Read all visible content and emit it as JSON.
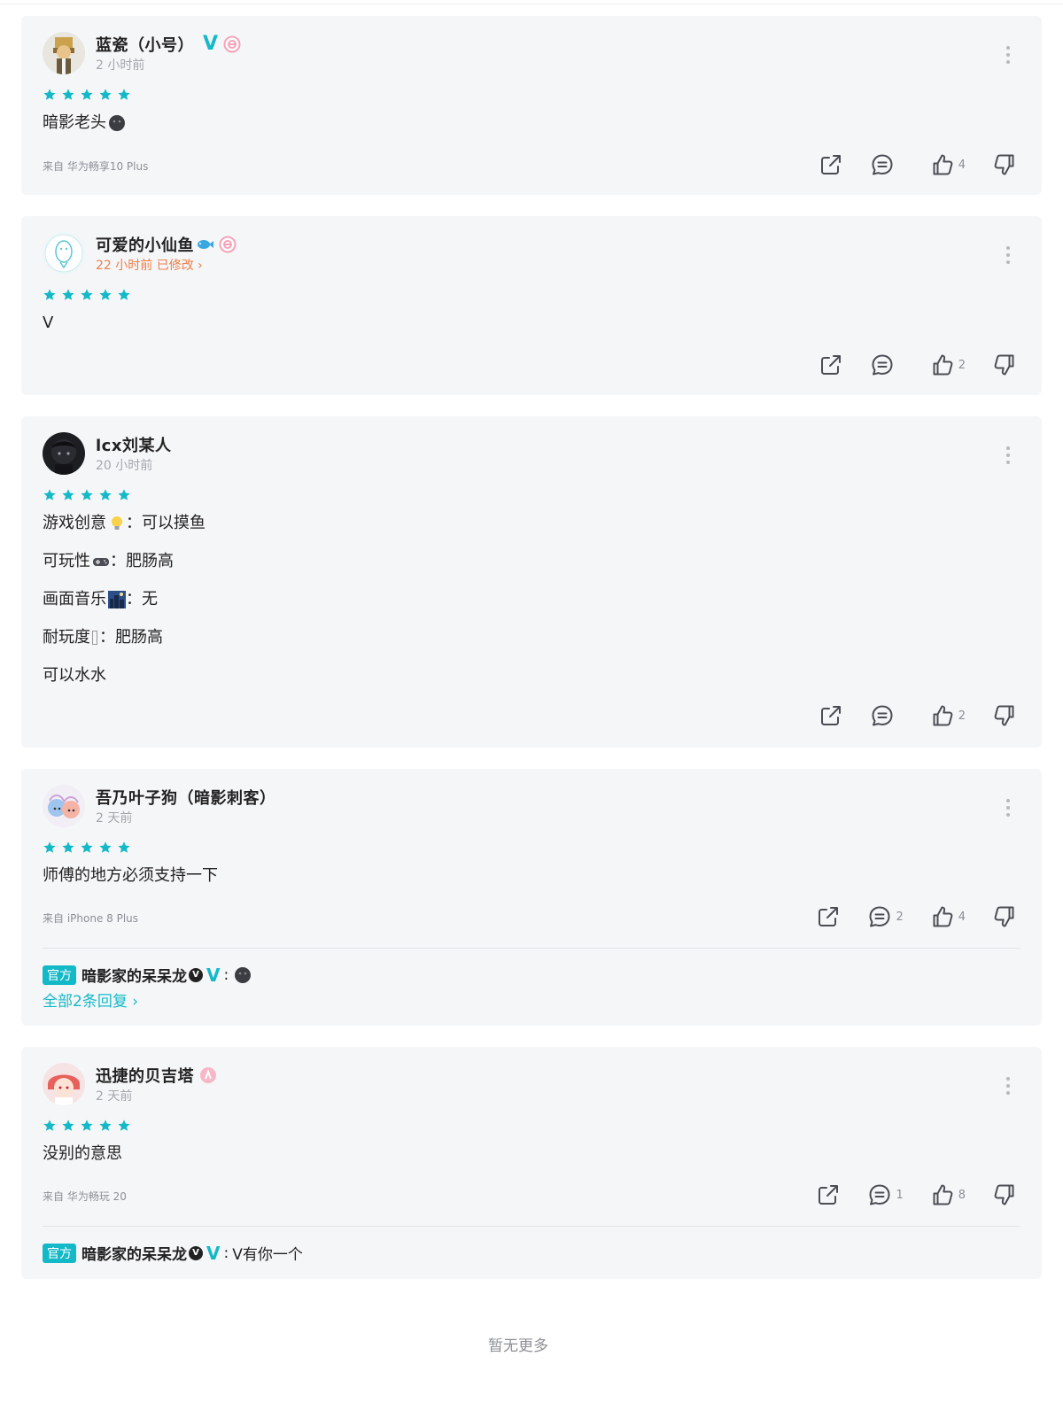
{
  "footer_text": "暂无更多",
  "reviews": [
    {
      "user": "蓝瓷（小号）",
      "time": "2 小时前",
      "rating": 5,
      "content": [
        "暗影老头"
      ],
      "device": "来自 华为畅享10 Plus",
      "likes": "4",
      "replies": "",
      "badges": [
        "v-verified",
        "pink-circle-badge"
      ]
    },
    {
      "user": "可爱的小仙鱼",
      "time": "22 小时前 已修改",
      "rating": 5,
      "content": [
        "V"
      ],
      "device": "",
      "likes": "2",
      "replies": "",
      "badges": [
        "fish-emoji",
        "pink-circle-badge"
      ]
    },
    {
      "user": "lcx刘某人",
      "time": "20 小时前",
      "rating": 5,
      "content": [
        "游戏创意",
        "：可以摸鱼",
        "可玩性",
        "：肥肠高",
        "画面音乐",
        "：无",
        "耐玩度",
        "：肥肠高",
        "可以水水"
      ],
      "device": "",
      "likes": "2",
      "replies": ""
    },
    {
      "user": "吾乃叶子狗（暗影刺客）",
      "time": "2 天前",
      "rating": 5,
      "content": [
        "师傅的地方必须支持一下"
      ],
      "device": "来自 iPhone 8 Plus",
      "likes": "4",
      "replies": "2",
      "official_reply": {
        "tag": "官方",
        "name": "暗影家的呆呆龙",
        "colon": ":",
        "text": ""
      },
      "all_replies": "全部2条回复"
    },
    {
      "user": "迅捷的贝吉塔",
      "time": "2 天前",
      "rating": 5,
      "content": [
        "没别的意思"
      ],
      "device": "来自 华为畅玩 20",
      "likes": "8",
      "replies": "1",
      "official_reply": {
        "tag": "官方",
        "name": "暗影家的呆呆龙",
        "colon": ":",
        "text": "V有你一个"
      }
    }
  ],
  "icons": {
    "share": "share-icon",
    "comment": "comment-icon",
    "like": "thumbs-up-icon",
    "dislike": "thumbs-down-icon",
    "more": "more-vertical-icon",
    "star": "star-icon"
  },
  "colors": {
    "accent": "#14b9c8",
    "edited": "#ee7f47",
    "card_bg": "#f5f6f8",
    "muted": "#a4a6ab"
  }
}
